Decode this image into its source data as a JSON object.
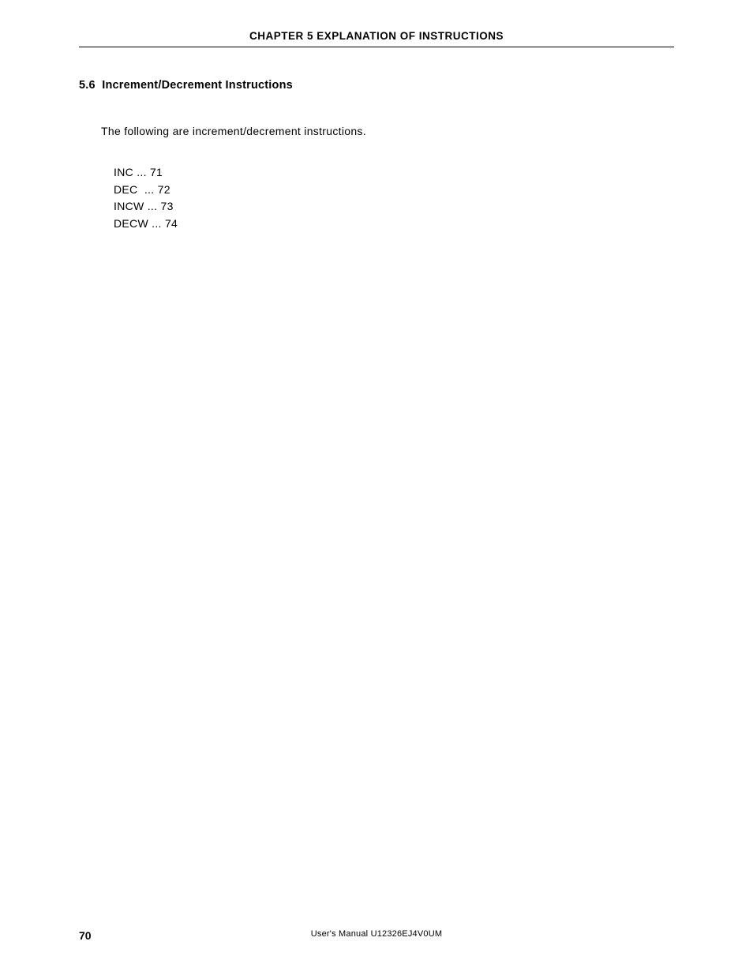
{
  "header": {
    "text": "CHAPTER 5  EXPLANATION OF INSTRUCTIONS"
  },
  "section": {
    "number": "5.6",
    "title": "Increment/Decrement Instructions"
  },
  "intro": "The following are increment/decrement instructions.",
  "instructions": [
    {
      "name": "INC",
      "page": "71"
    },
    {
      "name": "DEC",
      "page": "72"
    },
    {
      "name": "INCW",
      "page": "73"
    },
    {
      "name": "DECW",
      "page": "74"
    }
  ],
  "footer": {
    "page_number": "70",
    "manual": "User's Manual  U12326EJ4V0UM"
  }
}
